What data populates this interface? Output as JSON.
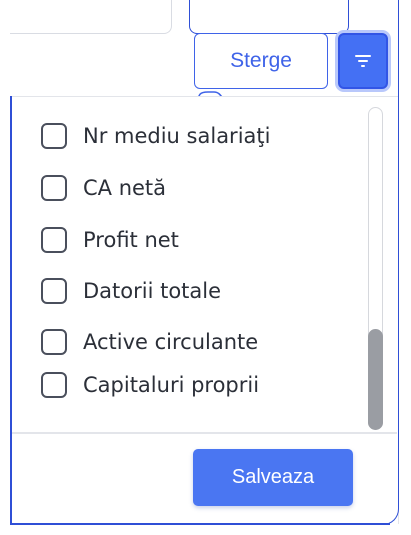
{
  "toolbar": {
    "clear_label": "Sterge",
    "filter_icon": "filter-icon"
  },
  "dropdown": {
    "options": [
      {
        "label": "Nr mediu salariaţi",
        "checked": false
      },
      {
        "label": "CA netă",
        "checked": false
      },
      {
        "label": "Profit net",
        "checked": false
      },
      {
        "label": "Datorii totale",
        "checked": false
      },
      {
        "label": "Active circulante",
        "checked": false
      },
      {
        "label": "Capitaluri proprii",
        "checked": false
      }
    ],
    "save_label": "Salveaza"
  },
  "colors": {
    "accent": "#4a76f2",
    "accent_border": "#2f4fd6",
    "text": "#2b2f38"
  }
}
